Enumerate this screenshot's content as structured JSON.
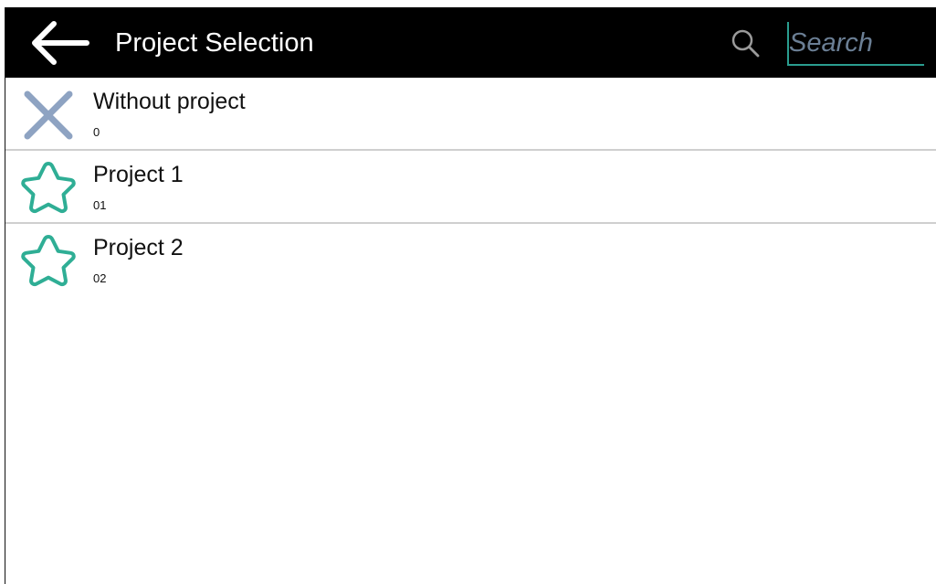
{
  "toolbar": {
    "back_icon": "arrow-left-icon",
    "title": "Project Selection",
    "search_icon": "search-icon",
    "search": {
      "value": "",
      "placeholder": "Search"
    },
    "background_color": "#000000",
    "accent_color": "#2a9d8f"
  },
  "projects": [
    {
      "name": "Without project",
      "code": "0",
      "icon": "close-icon",
      "icon_color": "#8ea3c2"
    },
    {
      "name": "Project 1",
      "code": "01",
      "icon": "star-icon",
      "icon_color": "#2fae95"
    },
    {
      "name": "Project 2",
      "code": "02",
      "icon": "star-icon",
      "icon_color": "#2fae95"
    }
  ]
}
